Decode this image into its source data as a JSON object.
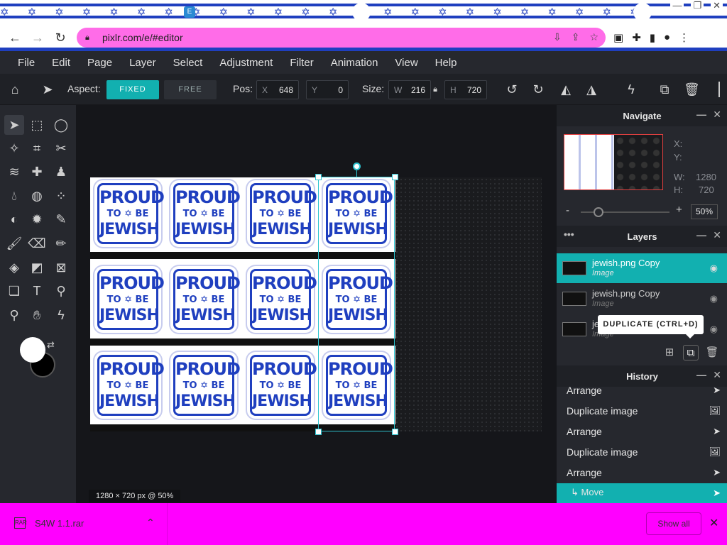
{
  "browser": {
    "tab_favicon_letter": "E",
    "url": "pixlr.com/e/#editor",
    "window_controls": [
      "—",
      "❐",
      "✕"
    ]
  },
  "menu": [
    "File",
    "Edit",
    "Page",
    "Layer",
    "Select",
    "Adjustment",
    "Filter",
    "Animation",
    "View",
    "Help"
  ],
  "toolbar": {
    "aspect_label": "Aspect:",
    "aspect_fixed": "FIXED",
    "aspect_free": "FREE",
    "aspect_selected": "FIXED",
    "pos_label": "Pos:",
    "x_key": "X",
    "x_value": "648",
    "y_key": "Y",
    "y_value": "0",
    "size_label": "Size:",
    "w_key": "W",
    "w_value": "216",
    "h_key": "H",
    "h_value": "720"
  },
  "canvas": {
    "status": "1280 × 720 px @ 50%",
    "sticker_line1": "PROUD",
    "sticker_line2": "TO ✡ BE",
    "sticker_line3": "JEWISH"
  },
  "navigate": {
    "title": "Navigate",
    "x_label": "X:",
    "y_label": "Y:",
    "w_label": "W:",
    "w_value": "1280",
    "h_label": "H:",
    "h_value": "720",
    "zoom": "50%"
  },
  "layers": {
    "title": "Layers",
    "items": [
      {
        "name": "jewish.png Copy",
        "type": "Image",
        "active": true
      },
      {
        "name": "jewish.png Copy",
        "type": "Image",
        "active": false
      },
      {
        "name": "je",
        "type": "Image",
        "active": false
      }
    ],
    "tooltip": "DUPLICATE (CTRL+D)"
  },
  "history": {
    "title": "History",
    "items": [
      {
        "label": "Arrange",
        "icon": "arrow-icon"
      },
      {
        "label": "Duplicate image",
        "icon": "image-icon"
      },
      {
        "label": "Arrange",
        "icon": "arrow-icon"
      },
      {
        "label": "Duplicate image",
        "icon": "image-icon"
      },
      {
        "label": "Arrange",
        "icon": "arrow-icon"
      },
      {
        "label": "↳ Move",
        "icon": "arrow-icon",
        "active": true
      }
    ]
  },
  "downloads": {
    "file_name": "S4W 1.1.rar",
    "show_all": "Show all"
  },
  "colors": {
    "accent": "#12b0b0",
    "download_bar": "#ff00ff",
    "omnibox": "#ff6ce8",
    "flag_blue": "#1f3fbf"
  }
}
